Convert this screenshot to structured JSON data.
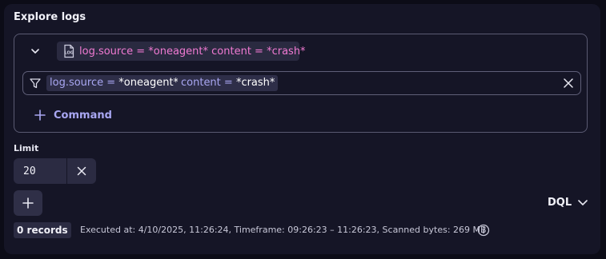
{
  "panel": {
    "title": "Explore logs"
  },
  "command": {
    "summary": "log.source = *oneagent* content = *crash*",
    "log_icon_text": "LOG",
    "filter_tokens": [
      {
        "key": "log.source =",
        "value": "*oneagent*"
      },
      {
        "key": "content =",
        "value": "*crash*"
      }
    ],
    "add_command_label": "Command"
  },
  "limit": {
    "label": "Limit",
    "value": "20"
  },
  "query_mode": {
    "label": "DQL"
  },
  "status": {
    "records": "0 records",
    "executed": "Executed at: 4/10/2025, 11:26:24, Timeframe: 09:26:23 – 11:26:23, Scanned bytes: 269 MB"
  },
  "colors": {
    "background": "#151526",
    "accent": "#a9a7f2",
    "summary_text": "#f07ad2",
    "border": "#5a5a72"
  },
  "icons": [
    "chevron-down-icon",
    "log-file-icon",
    "filter-icon",
    "close-icon",
    "plus-icon",
    "info-icon"
  ]
}
